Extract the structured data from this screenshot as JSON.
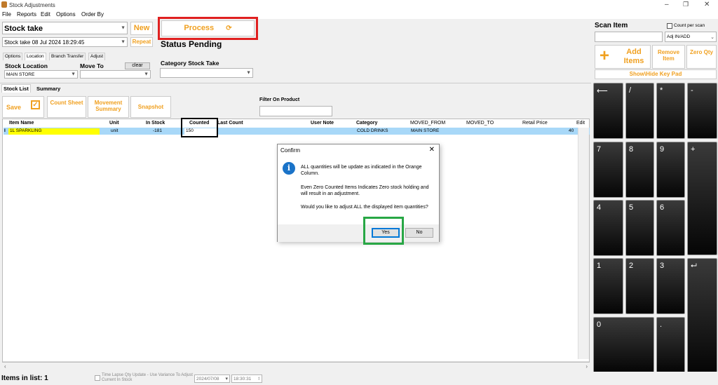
{
  "window": {
    "title": "Stock Adjustments"
  },
  "menu": [
    "File",
    "Reports",
    "Edit",
    "Options",
    "Order By"
  ],
  "toolbar": {
    "mode": "Stock take",
    "session": "Stock take 08 Jul 2024 18:29:45",
    "new_label": "New",
    "repeat_label": "Repeat",
    "process_label": "Process",
    "status": "Status Pending"
  },
  "tabs": [
    "Options",
    "Location",
    "Branch Transfer",
    "Adjust"
  ],
  "location": {
    "stock_location_label": "Stock Location",
    "stock_location_value": "MAIN STORE",
    "move_to_label": "Move To",
    "clear_label": "clear",
    "category_label": "Category Stock Take"
  },
  "list_tabs": [
    "Stock List",
    "Summary"
  ],
  "actions": {
    "save": "Save",
    "count_sheet": "Count Sheet",
    "movement_summary": "Movement Summary",
    "snapshot": "Snapshot"
  },
  "filter": {
    "label": "Filter On Product"
  },
  "columns": [
    "Item Name",
    "Unit",
    "In Stock",
    "Counted",
    "Last Count",
    "User Note",
    "Category",
    "MOVED_FROM",
    "MOVED_TO",
    "Retail Price",
    "Edit"
  ],
  "rows": [
    {
      "marker": "I",
      "item": "1L SPARKLING",
      "unit": "unit",
      "in_stock": "-181",
      "counted": "150",
      "last_count": "",
      "user_note": "",
      "category": "COLD DRINKS",
      "moved_from": "MAIN STORE",
      "moved_to": "",
      "retail_price": "40"
    }
  ],
  "scan": {
    "title": "Scan Item",
    "count_per_scan": "Count per scan",
    "adj_mode": "Adj IN/ADD",
    "add_items": "Add Items",
    "remove_item": "Remove Item",
    "zero_qty": "Zero Qty",
    "keypad_toggle": "Show\\Hide Key Pad"
  },
  "keypad": [
    "⟵",
    "/",
    "*",
    "-",
    "7",
    "8",
    "9",
    "+",
    "4",
    "5",
    "6",
    "1",
    "2",
    "3",
    "⮠",
    "0",
    "."
  ],
  "dialog": {
    "title": "Confirm",
    "msg1": "ALL quantities will be update as indicated in the Orange Column.",
    "msg2": "Even Zero Counted Items Indicates Zero stock holding and will result in an adjustment.",
    "msg3": "Would you like to adjust ALL the displayed item quantities?",
    "yes": "Yes",
    "no": "No"
  },
  "status_bar": {
    "items_count": "Items in list: 1",
    "time_lapse": "Time Lapse Qty Update - Use Variance To Adjust Current In Stock",
    "date": "2024/07/08",
    "time": "18:30:31"
  },
  "colors": {
    "accent_orange": "#f0a020",
    "highlight_red": "#e02020",
    "highlight_green": "#28a745",
    "row_select": "#a8d8f8",
    "item_yellow": "#ffff00"
  }
}
